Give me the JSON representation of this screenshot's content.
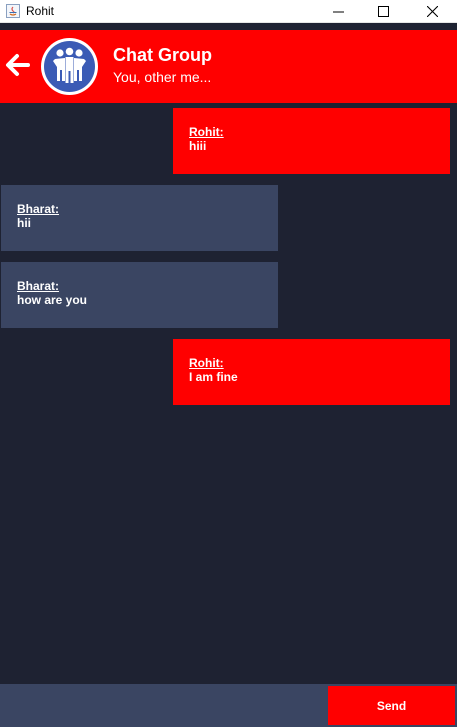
{
  "window": {
    "title": "Rohit",
    "app_icon": "java-app-icon",
    "minimize_icon": "minimize-icon",
    "maximize_icon": "maximize-icon",
    "close_icon": "close-icon"
  },
  "header": {
    "back_icon": "back-arrow-icon",
    "avatar_icon": "group-avatar-icon",
    "title": "Chat Group",
    "subtitle": "You, other me...",
    "background_color": "#ff0000"
  },
  "messages": [
    {
      "sender": "Rohit:",
      "text": "hiii",
      "direction": "outgoing"
    },
    {
      "sender": "Bharat:",
      "text": "hii",
      "direction": "incoming"
    },
    {
      "sender": "Bharat:",
      "text": "how are you",
      "direction": "incoming"
    },
    {
      "sender": "Rohit:",
      "text": "I am fine",
      "direction": "outgoing"
    }
  ],
  "composer": {
    "input_value": "",
    "send_label": "Send"
  },
  "colors": {
    "background": "#1e2232",
    "outgoing_bubble": "#ff0000",
    "incoming_bubble": "#3a4562",
    "text": "#ffffff"
  }
}
